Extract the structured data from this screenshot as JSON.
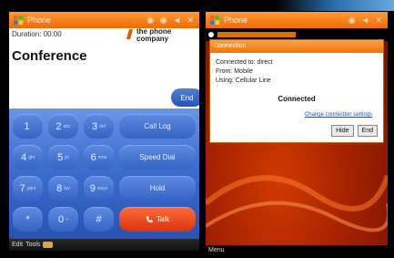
{
  "colors": {
    "titlebar_orange": "#f06a00",
    "keypad_blue": "#3e6fd1",
    "talk_red": "#d9340f",
    "wallpaper_red": "#a52200",
    "link_blue": "#2244cc"
  },
  "left_phone": {
    "titlebar": {
      "title": "Phone",
      "windows_icon": "windows-flag-icon",
      "status_icons": "◉ ◉ ◄ ✕"
    },
    "duration": "Duration: 00:00",
    "logo": {
      "icon": "carrier-logo-icon",
      "line1": "the phone",
      "line2": "company"
    },
    "call_title": "Conference",
    "end_button": "End",
    "keypad": {
      "keys": [
        {
          "digit": "1",
          "sub": ""
        },
        {
          "digit": "2",
          "sub": "abc"
        },
        {
          "digit": "3",
          "sub": "def"
        },
        {
          "digit": "4",
          "sub": "ghi"
        },
        {
          "digit": "5",
          "sub": "jkl"
        },
        {
          "digit": "6",
          "sub": "mno"
        },
        {
          "digit": "7",
          "sub": "pqrs"
        },
        {
          "digit": "8",
          "sub": "tuv"
        },
        {
          "digit": "9",
          "sub": "wxyz"
        },
        {
          "digit": "*",
          "sub": ""
        },
        {
          "digit": "0",
          "sub": "+"
        },
        {
          "digit": "#",
          "sub": ""
        }
      ],
      "side_buttons": [
        "Call Log",
        "Speed Dial",
        "Hold"
      ],
      "talk_button": "Talk"
    },
    "bottom_bar": {
      "left": "Edit",
      "right": "Tools"
    }
  },
  "right_phone": {
    "titlebar": {
      "title": "Phone",
      "windows_icon": "windows-flag-icon",
      "status_icons": "◉ ◄ ✕"
    },
    "dialog": {
      "title": "Connection",
      "lines": [
        "Connected to: direct",
        "From: Mobile",
        "Using: Cellular Line"
      ],
      "status": "Connected",
      "link": "Change connection settings",
      "buttons": [
        "Hide",
        "End"
      ]
    },
    "bottom_bar": {
      "left": "Menu"
    }
  }
}
